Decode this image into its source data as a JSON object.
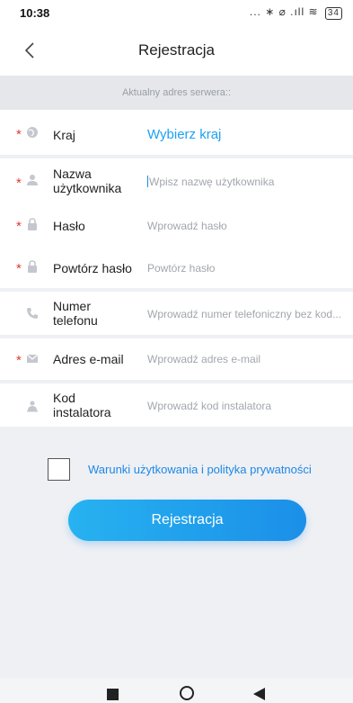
{
  "status": {
    "time": "10:38",
    "icons_text": "... ∗ ⌀ .ıll ≋",
    "battery": "34"
  },
  "header": {
    "title": "Rejestracja"
  },
  "server": {
    "label": "Aktualny adres serwera::"
  },
  "form": {
    "country": {
      "label": "Kraj",
      "value": "Wybierz kraj"
    },
    "username": {
      "label_line1": "Nazwa",
      "label_line2": "użytkownika",
      "placeholder": "Wpisz nazwę użytkownika"
    },
    "password": {
      "label": "Hasło",
      "placeholder": "Wprowadź hasło"
    },
    "password_repeat": {
      "label": "Powtórz hasło",
      "placeholder": "Powtórz hasło"
    },
    "phone": {
      "label_line1": "Numer",
      "label_line2": "telefonu",
      "placeholder": "Wprowadź numer telefoniczny bez kod..."
    },
    "email": {
      "label": "Adres e-mail",
      "placeholder": "Wprowadź adres e-mail"
    },
    "installer": {
      "label_line1": "Kod",
      "label_line2": "instalatora",
      "placeholder": "Wprowadź kod instalatora"
    }
  },
  "terms": {
    "label": "Warunki użytkowania i polityka prywatności",
    "checked": false
  },
  "register_button": {
    "label": "Rejestracja"
  },
  "required_marker": "*",
  "colors": {
    "accent": "#1da1f2",
    "required": "#e53935",
    "button_start": "#27b2f0",
    "button_end": "#1b8fe8"
  }
}
